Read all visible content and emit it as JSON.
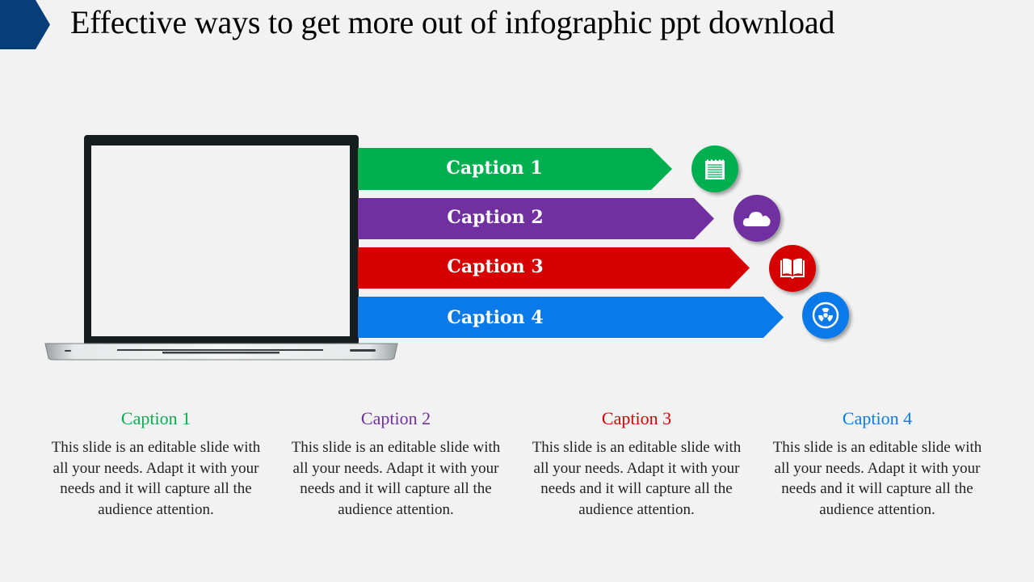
{
  "title": "Effective ways to get more out of infographic ppt download",
  "colors": {
    "title_tab": "#073e7a",
    "green": "#00b050",
    "purple": "#7030a0",
    "red": "#d60000",
    "blue": "#0a7aea"
  },
  "arrows": [
    {
      "label": "Caption 1",
      "icon": "notepad-icon"
    },
    {
      "label": "Caption 2",
      "icon": "cloud-icon"
    },
    {
      "label": "Caption 3",
      "icon": "open-book-icon"
    },
    {
      "label": "Caption 4",
      "icon": "radiation-icon"
    }
  ],
  "columns": [
    {
      "title": "Caption 1",
      "body": "This slide is an editable slide with all your needs. Adapt it with your needs and it will capture all the audience attention."
    },
    {
      "title": "Caption 2",
      "body": "This slide is an editable slide with all your needs. Adapt it with your needs and it will capture all the audience attention."
    },
    {
      "title": "Caption 3",
      "body": "This slide is an editable slide with all your needs. Adapt it with your needs and it will capture all the audience attention."
    },
    {
      "title": "Caption 4",
      "body": "This slide is an editable slide with all your needs. Adapt it with your needs and it will capture all the audience attention."
    }
  ]
}
